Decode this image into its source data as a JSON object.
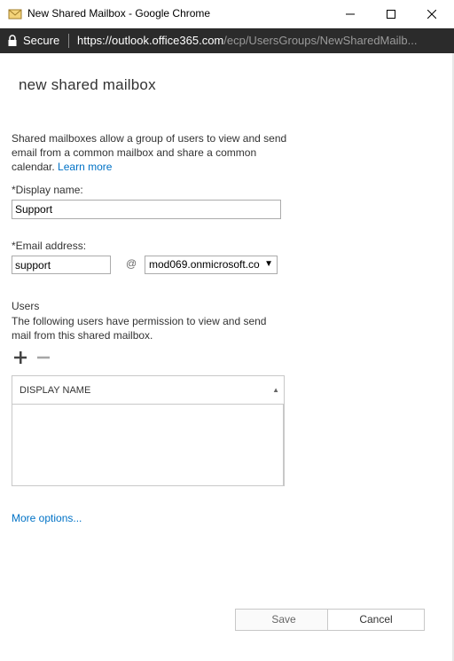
{
  "window": {
    "title": "New Shared Mailbox - Google Chrome",
    "app_icon": "mail-window-icon"
  },
  "address_bar": {
    "secure_label": "Secure",
    "url_host": "https://outlook.office365.com",
    "url_path": "/ecp/UsersGroups/NewSharedMailb..."
  },
  "page": {
    "title": "new shared mailbox",
    "description": "Shared mailboxes allow a group of users to view and send email from a common mailbox and share a common calendar.",
    "learn_more": "Learn more"
  },
  "form": {
    "display_name_label": "*Display name:",
    "display_name_value": "Support",
    "email_label": "*Email address:",
    "email_value": "support",
    "at_sign": "@",
    "domain_selected": "mod069.onmicrosoft.co"
  },
  "users": {
    "title": "Users",
    "description": "The following users have permission to view and send mail from this shared mailbox.",
    "add_icon": "plus-icon",
    "remove_icon": "minus-icon",
    "column_header": "DISPLAY NAME",
    "rows": []
  },
  "more_options": "More options...",
  "buttons": {
    "save": "Save",
    "cancel": "Cancel"
  },
  "colors": {
    "link": "#0072c6",
    "address_bar_bg": "#2b2b2b"
  }
}
